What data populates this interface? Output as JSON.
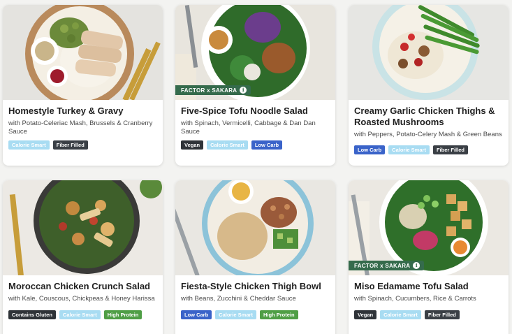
{
  "badge_styles": {
    "Calorie Smart": {
      "bg": "#a8dcf2",
      "fg": "#ffffff"
    },
    "Fiber Filled": {
      "bg": "#3a3f45",
      "fg": "#ffffff"
    },
    "Vegan": {
      "bg": "#2f3338",
      "fg": "#ffffff"
    },
    "Low Carb": {
      "bg": "#3a63c9",
      "fg": "#ffffff"
    },
    "Contains Gluten": {
      "bg": "#2f3338",
      "fg": "#ffffff"
    },
    "High Protein": {
      "bg": "#4f9e45",
      "fg": "#ffffff"
    }
  },
  "meals": [
    {
      "title": "Homestyle Turkey & Gravy",
      "subtitle": "with Potato-Celeriac Mash, Brussels & Cranberry Sauce",
      "badges": [
        "Calorie Smart",
        "Fiber Filled"
      ],
      "promo": "",
      "photo": "turkey-plate-image"
    },
    {
      "title": "Five-Spice Tofu Noodle Salad",
      "subtitle": "with Spinach, Vermicelli, Cabbage & Dan Dan Sauce",
      "badges": [
        "Vegan",
        "Calorie Smart",
        "Low Carb"
      ],
      "promo": "FACTOR x SAKARA",
      "photo": "noodle-salad-image"
    },
    {
      "title": "Creamy Garlic Chicken Thighs & Roasted Mushrooms",
      "subtitle": "with Peppers, Potato-Celery Mash & Green Beans",
      "badges": [
        "Low Carb",
        "Calorie Smart",
        "Fiber Filled"
      ],
      "promo": "",
      "photo": "chicken-thighs-image"
    },
    {
      "title": "Moroccan Chicken Crunch Salad",
      "subtitle": "with Kale, Couscous, Chickpeas & Honey Harissa",
      "badges": [
        "Contains Gluten",
        "Calorie Smart",
        "High Protein"
      ],
      "promo": "",
      "photo": "moroccan-salad-image"
    },
    {
      "title": "Fiesta-Style Chicken Thigh Bowl",
      "subtitle": "with Beans, Zucchini & Cheddar Sauce",
      "badges": [
        "Low Carb",
        "Calorie Smart",
        "High Protein"
      ],
      "promo": "",
      "photo": "fiesta-bowl-image"
    },
    {
      "title": "Miso Edamame Tofu Salad",
      "subtitle": "with Spinach, Cucumbers, Rice & Carrots",
      "badges": [
        "Vegan",
        "Calorie Smart",
        "Fiber Filled"
      ],
      "promo": "FACTOR x SAKARA",
      "photo": "tofu-salad-image"
    }
  ]
}
